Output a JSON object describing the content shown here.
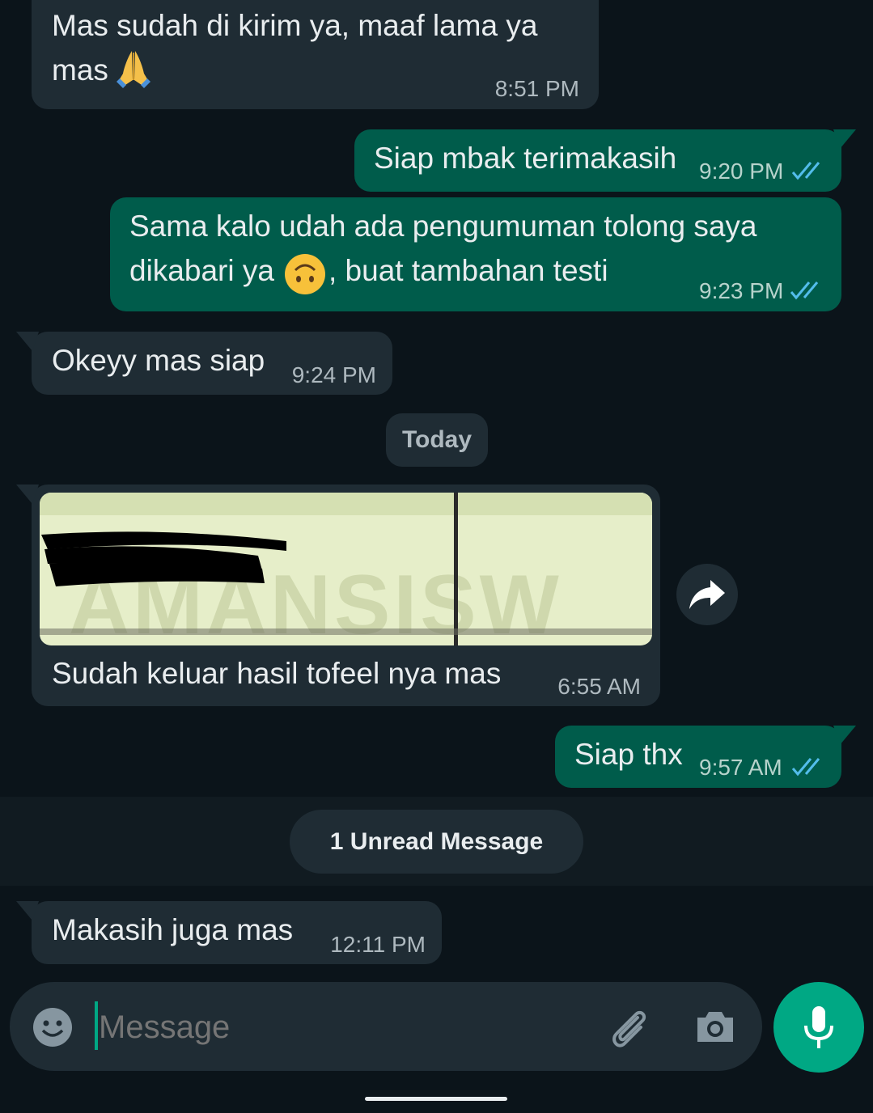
{
  "messages": [
    {
      "text_line1": "Mas sudah di kirim ya, maaf lama ya",
      "text_line2": "mas",
      "emoji": "folded-hands",
      "time": "8:51 PM"
    },
    {
      "text": "Siap mbak terimakasih",
      "time": "9:20 PM",
      "status": "read"
    },
    {
      "text_line1": "Sama kalo udah ada pengumuman tolong saya",
      "text_line2a": "dikabari ya",
      "emoji": "upside-down-face",
      "text_line2b": ", buat tambahan testi",
      "time": "9:23 PM",
      "status": "read"
    },
    {
      "text": "Okeyy mas siap",
      "time": "9:24 PM"
    },
    {
      "image_caption": "Sudah keluar hasil tofeel nya mas",
      "image_watermark": "AMANSISW",
      "time": "6:55 AM"
    },
    {
      "text": "Siap thx",
      "time": "9:57 AM",
      "status": "read"
    },
    {
      "text": "Makasih juga mas",
      "time": "12:11 PM"
    }
  ],
  "date_divider": "Today",
  "unread_banner": "1 Unread Message",
  "composer": {
    "placeholder": "Message"
  },
  "icons": {
    "emoji": "emoji-icon",
    "attach": "paperclip-icon",
    "camera": "camera-icon",
    "mic": "mic-icon",
    "forward": "forward-icon"
  },
  "colors": {
    "background": "#0b141a",
    "incoming": "#1f2c34",
    "outgoing": "#005c4b",
    "accent": "#00a884",
    "read_ticks": "#53bdeb"
  }
}
